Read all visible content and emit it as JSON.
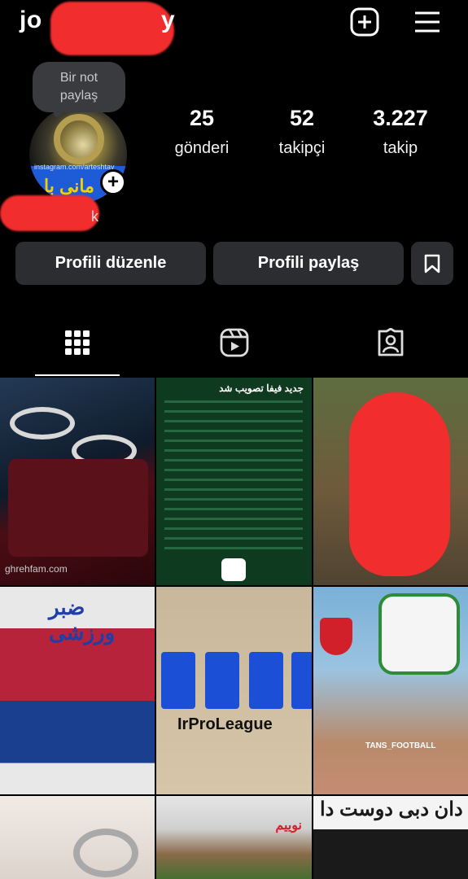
{
  "header": {
    "username_visible": "jo",
    "username_tail": "y",
    "new_post_icon": "plus-square-icon",
    "menu_icon": "hamburger-icon"
  },
  "profile": {
    "note_text": "Bir not paylaş",
    "avatar_site_text": "instagram.com/arteshtay",
    "avatar_arabic_text": "مانی با",
    "name_tail": "k",
    "stats": [
      {
        "value": "25",
        "label": "gönderi"
      },
      {
        "value": "52",
        "label": "takipçi"
      },
      {
        "value": "3.227",
        "label": "takip"
      }
    ]
  },
  "actions": {
    "edit_profile": "Profili düzenle",
    "share_profile": "Profili paylaş",
    "discover_icon": "person-add-icon"
  },
  "tabs": [
    {
      "name": "grid",
      "icon": "grid-icon",
      "active": true
    },
    {
      "name": "reels",
      "icon": "reels-icon",
      "active": false
    },
    {
      "name": "tagged",
      "icon": "tagged-icon",
      "active": false
    }
  ],
  "posts": [
    {
      "caption": "ghrehfam.com"
    },
    {
      "caption": "جدید فیفا تصویب شد"
    },
    {
      "caption": ""
    },
    {
      "caption": "ضبر ورزشی"
    },
    {
      "caption": "IrProLeague"
    },
    {
      "caption": "TANS_FOOTBALL"
    },
    {
      "caption": ""
    },
    {
      "caption": "نوییم"
    },
    {
      "caption": "دان دبی دوست دا"
    }
  ]
}
